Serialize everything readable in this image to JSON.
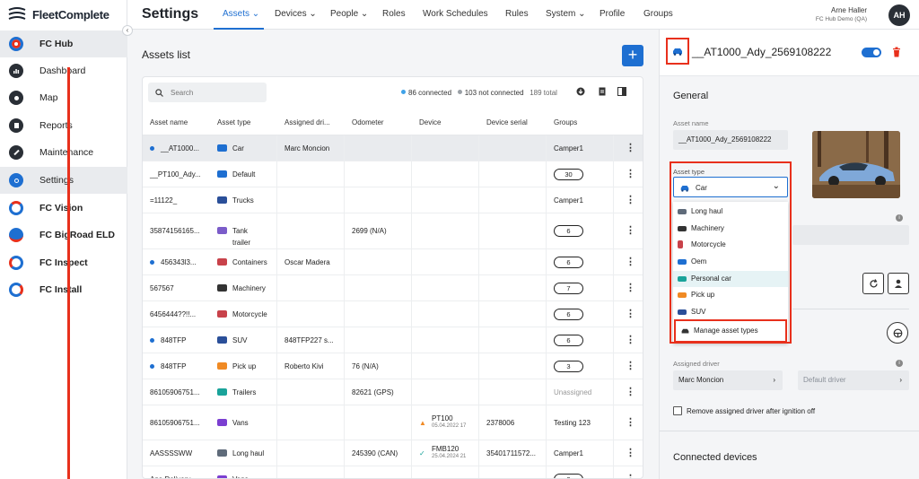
{
  "brand": {
    "name": "FleetComplete"
  },
  "sidebar": {
    "items": [
      {
        "label": "FC Hub",
        "icon": "fc-hub-icon"
      },
      {
        "label": "Dashboard",
        "icon": "dashboard-icon"
      },
      {
        "label": "Map",
        "icon": "map-pin-icon"
      },
      {
        "label": "Reports",
        "icon": "reports-icon"
      },
      {
        "label": "Maintenance",
        "icon": "wrench-icon"
      },
      {
        "label": "Settings",
        "icon": "gear-icon"
      },
      {
        "label": "FC Vision",
        "icon": "fc-vision-icon"
      },
      {
        "label": "FC BigRoad ELD",
        "icon": "fc-bigroad-icon"
      },
      {
        "label": "FC Inspect",
        "icon": "fc-inspect-icon"
      },
      {
        "label": "FC Install",
        "icon": "fc-install-icon"
      }
    ]
  },
  "header": {
    "title": "Settings",
    "tabs": [
      "Assets",
      "Devices",
      "People",
      "Roles",
      "Work Schedules",
      "Rules",
      "System",
      "Profile",
      "Groups"
    ],
    "user_name": "Arne Haller",
    "user_sub": "FC Hub Demo (QA)",
    "avatar": "AH"
  },
  "assets": {
    "title": "Assets list",
    "add_label": "+",
    "search_placeholder": "Search",
    "connected": "86 connected",
    "not_connected": "103 not connected",
    "total": "189 total",
    "columns": [
      "Asset name",
      "Asset type",
      "Assigned dri...",
      "Odometer",
      "Device",
      "Device serial",
      "Groups"
    ],
    "rows": [
      {
        "name": "__AT1000...",
        "dot": true,
        "type": "Car",
        "driver": "Marc Moncion",
        "odometer": "",
        "device": "",
        "device_date": "",
        "serial": "",
        "group": "Camper1",
        "badge": false
      },
      {
        "name": "__PT100_Ady...",
        "dot": false,
        "type": "Default",
        "driver": "",
        "odometer": "",
        "device": "",
        "device_date": "",
        "serial": "",
        "group": "30",
        "badge": true
      },
      {
        "name": "=11122_",
        "dot": false,
        "type": "Trucks",
        "driver": "",
        "odometer": "",
        "device": "",
        "device_date": "",
        "serial": "",
        "group": "Camper1",
        "badge": false
      },
      {
        "name": "35874156165...",
        "dot": false,
        "type": "Tank",
        "type2": "trailer",
        "driver": "",
        "odometer": "2699 (N/A)",
        "device": "",
        "device_date": "",
        "serial": "",
        "group": "6",
        "badge": true
      },
      {
        "name": "456343l3...",
        "dot": true,
        "type": "Containers",
        "driver": "Oscar Madera",
        "odometer": "",
        "device": "",
        "device_date": "",
        "serial": "",
        "group": "6",
        "badge": true
      },
      {
        "name": "567567",
        "dot": false,
        "type": "Machinery",
        "driver": "",
        "odometer": "",
        "device": "",
        "device_date": "",
        "serial": "",
        "group": "7",
        "badge": true
      },
      {
        "name": "6456444??!!...",
        "dot": false,
        "type": "Motorcycle",
        "driver": "",
        "odometer": "",
        "device": "",
        "device_date": "",
        "serial": "",
        "group": "6",
        "badge": true
      },
      {
        "name": "848TFP",
        "dot": true,
        "type": "SUV",
        "driver": "848TFP227 s...",
        "odometer": "",
        "device": "",
        "device_date": "",
        "serial": "",
        "group": "6",
        "badge": true
      },
      {
        "name": "848TFP",
        "dot": true,
        "type": "Pick up",
        "driver": "Roberto Kivi",
        "odometer": "76 (N/A)",
        "device": "",
        "device_date": "",
        "serial": "",
        "group": "3",
        "badge": true
      },
      {
        "name": "86105906751...",
        "dot": false,
        "type": "Trailers",
        "driver": "",
        "odometer": "82621 (GPS)",
        "device": "",
        "device_date": "",
        "serial": "",
        "group": "Unassigned",
        "badge": false
      },
      {
        "name": "86105906751...",
        "dot": false,
        "type": "Vans",
        "driver": "",
        "odometer": "",
        "device": "PT100",
        "device_date": "05.04.2022 17",
        "serial": "2378006",
        "group": "Testing 123",
        "badge": false
      },
      {
        "name": "AASSSSWW",
        "dot": false,
        "type": "Long haul",
        "driver": "",
        "odometer": "245390 (CAN)",
        "device": "FMB120",
        "device_date": "25.04.2024 21",
        "serial": "35401711572...",
        "group": "Camper1",
        "badge": false
      },
      {
        "name": "Ana Delivery",
        "dot": false,
        "type": "Vans",
        "driver": "",
        "odometer": "",
        "device": "",
        "device_date": "",
        "serial": "",
        "group": "2",
        "badge": true
      }
    ]
  },
  "panel": {
    "asset_title": "__AT1000_Ady_2569108222",
    "general": "General",
    "asset_name_label": "Asset name",
    "asset_name_value": "__AT1000_Ady_2569108222",
    "asset_type_label": "Asset type",
    "asset_type_value": "Car",
    "options": [
      "Long haul",
      "Machinery",
      "Motorcycle",
      "Oem",
      "Personal car",
      "Pick up",
      "SUV"
    ],
    "manage_label": "Manage asset types",
    "assigned_driver_label": "Assigned driver",
    "assigned_driver_value": "Marc Moncion",
    "default_driver_placeholder": "Default driver",
    "remove_driver_label": "Remove assigned driver after ignition off",
    "connected_devices": "Connected devices"
  },
  "colors": {
    "accent": "#1e6fd1",
    "highlight": "#e8301c",
    "connected": "#3fa2e8",
    "not_connected": "#9aa0a6"
  }
}
